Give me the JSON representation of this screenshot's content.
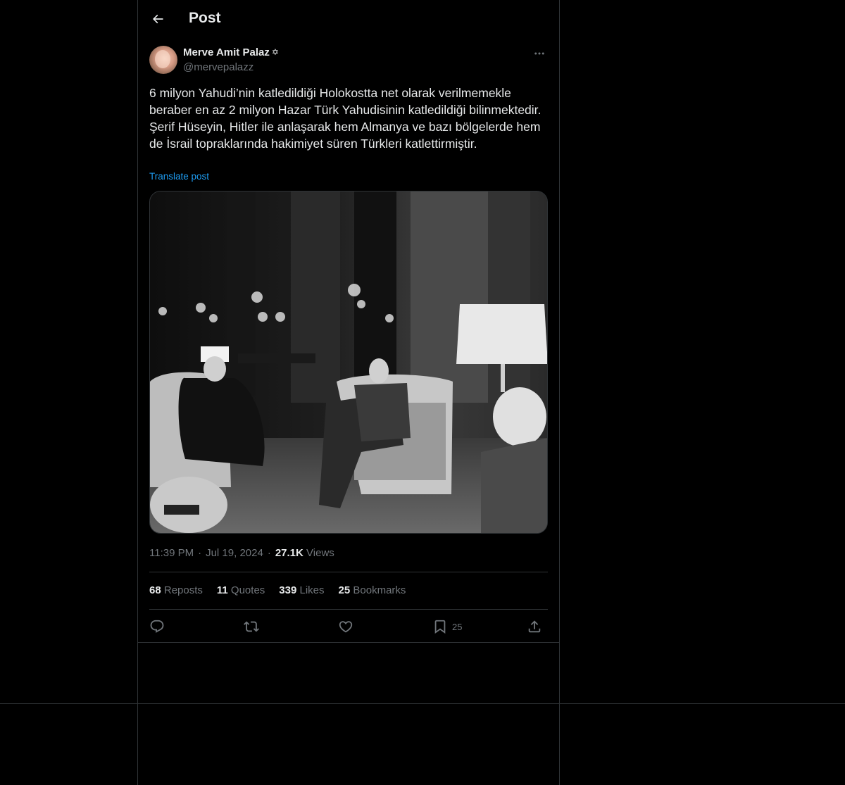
{
  "header": {
    "title": "Post"
  },
  "author": {
    "name": "Merve Amit Palaz",
    "badge": "✡",
    "handle": "@mervepalazz"
  },
  "post": {
    "text": "6 milyon Yahudi’nin katledildiği Holokostta net olarak verilmemekle beraber en az 2 milyon Hazar Türk Yahudisinin katledildiği bilinmektedir. Şerif Hüseyin, Hitler ile anlaşarak hem Almanya ve bazı bölgelerde hem de İsrail topraklarında hakimiyet süren Türkleri katlettirmiştir.",
    "translate_label": "Translate post",
    "time": "11:39 PM",
    "date": "Jul 19, 2024",
    "views_count": "27.1K",
    "views_label": "Views"
  },
  "stats": [
    {
      "count": "68",
      "label": "Reposts"
    },
    {
      "count": "11",
      "label": "Quotes"
    },
    {
      "count": "339",
      "label": "Likes"
    },
    {
      "count": "25",
      "label": "Bookmarks"
    }
  ],
  "actions": {
    "bookmark_count": "25"
  },
  "colors": {
    "background": "#000000",
    "text": "#e7e9ea",
    "secondary": "#71767b",
    "border": "#2f3336",
    "link": "#1d9bf0"
  },
  "icons": {
    "back": "arrow-left-icon",
    "more": "more-horizontal-icon",
    "reply": "reply-icon",
    "repost": "repost-icon",
    "like": "heart-icon",
    "bookmark": "bookmark-icon",
    "share": "share-icon"
  }
}
